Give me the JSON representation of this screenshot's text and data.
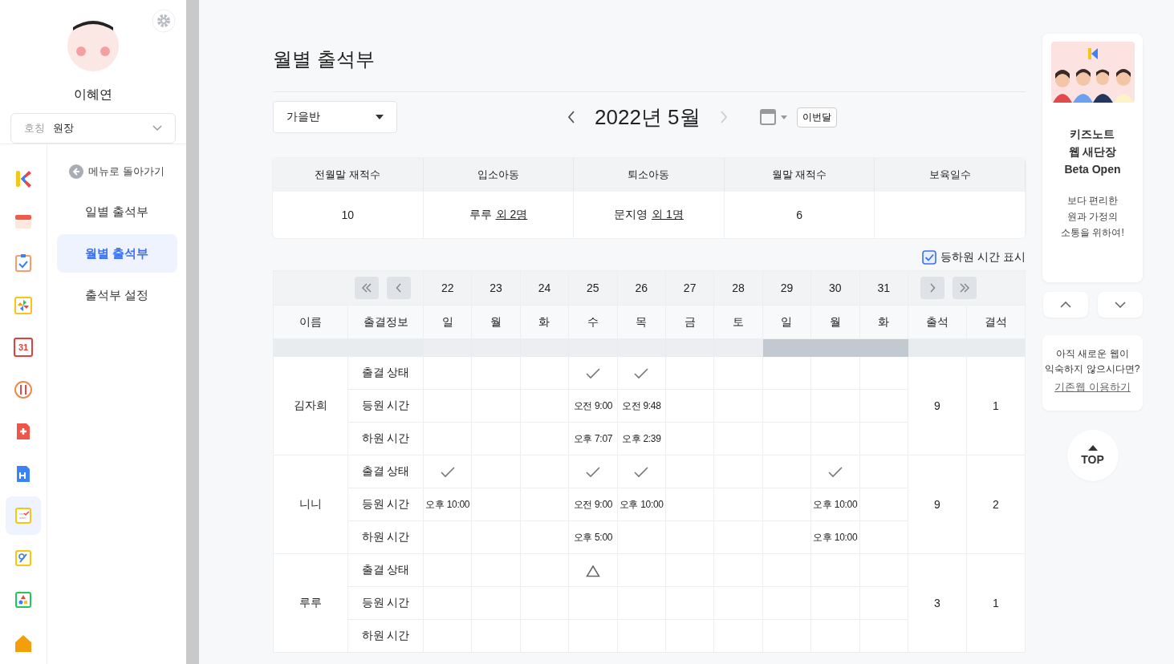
{
  "sidebar": {
    "user_name": "이혜연",
    "title_select": {
      "label": "호칭",
      "value": "원장"
    },
    "apps": [
      {
        "kind": "k-logo",
        "selected": false
      },
      {
        "kind": "calendar-strip",
        "selected": false
      },
      {
        "kind": "checklist",
        "selected": false
      },
      {
        "kind": "pinwheel",
        "selected": false
      },
      {
        "kind": "calendar-day",
        "text": "31",
        "selected": false
      },
      {
        "kind": "meal",
        "selected": false
      },
      {
        "kind": "medical",
        "selected": false
      },
      {
        "kind": "document",
        "selected": false
      },
      {
        "kind": "attendance",
        "selected": true
      },
      {
        "kind": "drawing",
        "selected": false
      },
      {
        "kind": "shapes",
        "selected": false
      },
      {
        "kind": "home",
        "selected": false
      }
    ],
    "back_link": "메뉴로 돌아가기",
    "menu": [
      {
        "label": "일별 출석부",
        "selected": false
      },
      {
        "label": "월별 출석부",
        "selected": true
      },
      {
        "label": "출석부 설정",
        "selected": false
      }
    ]
  },
  "page_title": "월별 출석부",
  "class_select": "가을반",
  "month": {
    "label": "2022년 5월",
    "next_disabled": true
  },
  "this_month_button": "이번달",
  "summary": {
    "columns": [
      "전월말 재적수",
      "입소아동",
      "퇴소아동",
      "월말 재적수",
      "보육일수"
    ],
    "values": [
      {
        "text": "10"
      },
      {
        "text": "루루",
        "link": "외 2명"
      },
      {
        "text": "문지영",
        "link": "외 1명"
      },
      {
        "text": "6"
      }
    ]
  },
  "show_times": {
    "label": "등하원 시간 표시",
    "checked": true
  },
  "table": {
    "headers": {
      "name": "이름",
      "info": "출결정보",
      "present": "출석",
      "absent": "결석"
    },
    "days": [
      {
        "date": "22",
        "weekday": "일",
        "highlighted": false
      },
      {
        "date": "23",
        "weekday": "월",
        "highlighted": false
      },
      {
        "date": "24",
        "weekday": "화",
        "highlighted": false
      },
      {
        "date": "25",
        "weekday": "수",
        "highlighted": false
      },
      {
        "date": "26",
        "weekday": "목",
        "highlighted": false
      },
      {
        "date": "27",
        "weekday": "금",
        "highlighted": false
      },
      {
        "date": "28",
        "weekday": "토",
        "highlighted": false
      },
      {
        "date": "29",
        "weekday": "일",
        "highlighted": true
      },
      {
        "date": "30",
        "weekday": "월",
        "highlighted": true
      },
      {
        "date": "31",
        "weekday": "화",
        "highlighted": true
      }
    ],
    "students": [
      {
        "name": "김자희",
        "present": "9",
        "absent": "1",
        "rows": [
          {
            "label": "출결 상태",
            "cells": [
              {
                "kind": "empty"
              },
              {
                "kind": "empty"
              },
              {
                "kind": "empty"
              },
              {
                "kind": "check"
              },
              {
                "kind": "check"
              },
              {
                "kind": "empty"
              },
              {
                "kind": "empty"
              },
              {
                "kind": "empty"
              },
              {
                "kind": "empty"
              },
              {
                "kind": "empty"
              }
            ]
          },
          {
            "label": "등원 시간",
            "cells": [
              {
                "kind": "empty"
              },
              {
                "kind": "empty"
              },
              {
                "kind": "empty"
              },
              {
                "kind": "time",
                "text": "오전 9:00"
              },
              {
                "kind": "time",
                "text": "오전 9:48"
              },
              {
                "kind": "empty"
              },
              {
                "kind": "empty"
              },
              {
                "kind": "empty"
              },
              {
                "kind": "empty"
              },
              {
                "kind": "empty"
              }
            ]
          },
          {
            "label": "하원 시간",
            "cells": [
              {
                "kind": "empty"
              },
              {
                "kind": "empty"
              },
              {
                "kind": "empty"
              },
              {
                "kind": "time",
                "text": "오후 7:07"
              },
              {
                "kind": "time",
                "text": "오후 2:39"
              },
              {
                "kind": "empty"
              },
              {
                "kind": "empty"
              },
              {
                "kind": "empty"
              },
              {
                "kind": "empty"
              },
              {
                "kind": "empty"
              }
            ]
          }
        ]
      },
      {
        "name": "니니",
        "present": "9",
        "absent": "2",
        "rows": [
          {
            "label": "출결 상태",
            "cells": [
              {
                "kind": "check"
              },
              {
                "kind": "empty"
              },
              {
                "kind": "empty"
              },
              {
                "kind": "check"
              },
              {
                "kind": "check"
              },
              {
                "kind": "empty"
              },
              {
                "kind": "empty"
              },
              {
                "kind": "empty"
              },
              {
                "kind": "check"
              },
              {
                "kind": "empty"
              }
            ]
          },
          {
            "label": "등원 시간",
            "cells": [
              {
                "kind": "time",
                "text": "오후 10:00"
              },
              {
                "kind": "empty"
              },
              {
                "kind": "empty"
              },
              {
                "kind": "time",
                "text": "오전 9:00"
              },
              {
                "kind": "time",
                "text": "오후 10:00"
              },
              {
                "kind": "empty"
              },
              {
                "kind": "empty"
              },
              {
                "kind": "empty"
              },
              {
                "kind": "time",
                "text": "오후 10:00"
              },
              {
                "kind": "empty"
              }
            ]
          },
          {
            "label": "하원 시간",
            "cells": [
              {
                "kind": "empty"
              },
              {
                "kind": "empty"
              },
              {
                "kind": "empty"
              },
              {
                "kind": "time",
                "text": "오후 5:00"
              },
              {
                "kind": "empty"
              },
              {
                "kind": "empty"
              },
              {
                "kind": "empty"
              },
              {
                "kind": "empty"
              },
              {
                "kind": "time",
                "text": "오후 10:00"
              },
              {
                "kind": "empty"
              }
            ]
          }
        ]
      },
      {
        "name": "루루",
        "present": "3",
        "absent": "1",
        "rows": [
          {
            "label": "출결 상태",
            "cells": [
              {
                "kind": "empty"
              },
              {
                "kind": "empty"
              },
              {
                "kind": "empty"
              },
              {
                "kind": "triangle"
              },
              {
                "kind": "empty"
              },
              {
                "kind": "empty"
              },
              {
                "kind": "empty"
              },
              {
                "kind": "empty"
              },
              {
                "kind": "empty"
              },
              {
                "kind": "empty"
              }
            ]
          },
          {
            "label": "등원 시간",
            "cells": [
              {
                "kind": "empty"
              },
              {
                "kind": "empty"
              },
              {
                "kind": "empty"
              },
              {
                "kind": "empty"
              },
              {
                "kind": "empty"
              },
              {
                "kind": "empty"
              },
              {
                "kind": "empty"
              },
              {
                "kind": "empty"
              },
              {
                "kind": "empty"
              },
              {
                "kind": "empty"
              }
            ]
          },
          {
            "label": "하원 시간",
            "cells": [
              {
                "kind": "empty"
              },
              {
                "kind": "empty"
              },
              {
                "kind": "empty"
              },
              {
                "kind": "empty"
              },
              {
                "kind": "empty"
              },
              {
                "kind": "empty"
              },
              {
                "kind": "empty"
              },
              {
                "kind": "empty"
              },
              {
                "kind": "empty"
              },
              {
                "kind": "empty"
              }
            ]
          }
        ]
      }
    ]
  },
  "promo": {
    "title_lines": [
      "키즈노트",
      "웹 새단장",
      "Beta Open"
    ],
    "text_lines": [
      "보다 편리한",
      "원과 가정의",
      "소통을 위하여!"
    ]
  },
  "old_web": {
    "text_lines": [
      "아직 새로운 웹이",
      "익숙하지 않으시다면?"
    ],
    "link": "기존웹 이용하기"
  },
  "top_button": "TOP"
}
